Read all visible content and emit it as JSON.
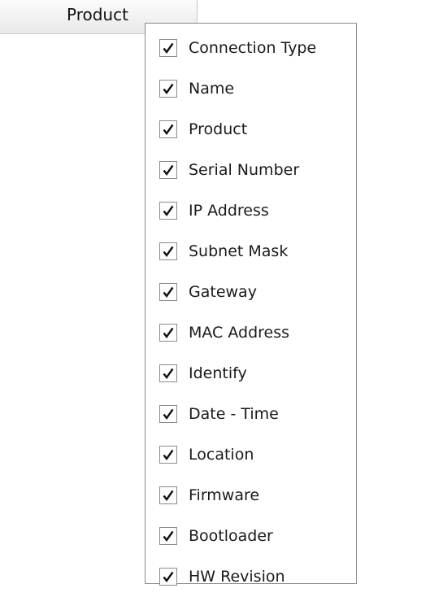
{
  "column_header": {
    "label": "Product"
  },
  "column_menu": {
    "items": [
      {
        "label": "Connection Type",
        "checked": true
      },
      {
        "label": "Name",
        "checked": true
      },
      {
        "label": "Product",
        "checked": true
      },
      {
        "label": "Serial Number",
        "checked": true
      },
      {
        "label": "IP Address",
        "checked": true
      },
      {
        "label": "Subnet Mask",
        "checked": true
      },
      {
        "label": "Gateway",
        "checked": true
      },
      {
        "label": "MAC Address",
        "checked": true
      },
      {
        "label": "Identify",
        "checked": true
      },
      {
        "label": "Date - Time",
        "checked": true
      },
      {
        "label": "Location",
        "checked": true
      },
      {
        "label": "Firmware",
        "checked": true
      },
      {
        "label": "Bootloader",
        "checked": true
      },
      {
        "label": "HW Revision",
        "checked": true
      }
    ]
  },
  "icons": {
    "checkmark": "checkmark-icon"
  },
  "colors": {
    "check": "#111111",
    "checkbox_border": "#8a8a8a",
    "menu_border": "#8c8c8c"
  }
}
